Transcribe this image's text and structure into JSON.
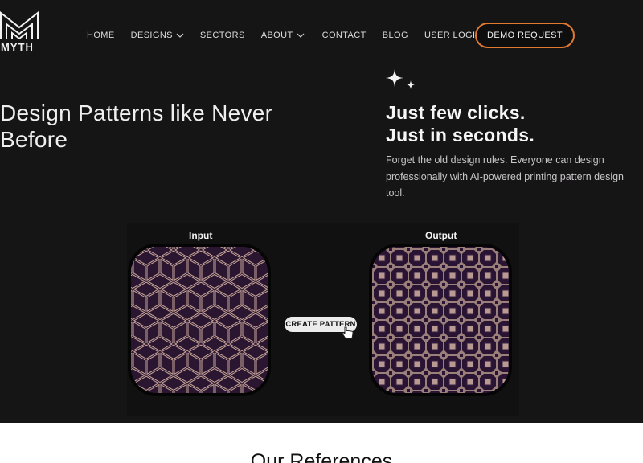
{
  "brand": {
    "name": "MYTH"
  },
  "nav": {
    "items": [
      {
        "label": "HOME",
        "dropdown": false
      },
      {
        "label": "DESIGNS",
        "dropdown": true
      },
      {
        "label": "SECTORS",
        "dropdown": false
      },
      {
        "label": "ABOUT",
        "dropdown": true
      },
      {
        "label": "CONTACT",
        "dropdown": false
      },
      {
        "label": "BLOG",
        "dropdown": false
      },
      {
        "label": "USER LOGIN",
        "dropdown": false
      }
    ],
    "cta_label": "DEMO REQUEST"
  },
  "hero": {
    "title": "Design Patterns like Never Before",
    "tagline_line1": "Just few clicks.",
    "tagline_line2": "Just in seconds.",
    "description": "Forget the old design rules. Everyone can design professionally with AI-powered printing pattern design tool."
  },
  "demo": {
    "input_label": "Input",
    "output_label": "Output",
    "button_label": "CREATE PATTERN"
  },
  "references": {
    "title": "Our References"
  },
  "colors": {
    "background": "#161516",
    "accent": "#e07a2e",
    "pattern_base": "#2b1631",
    "pattern_line": "#c9a89a"
  }
}
